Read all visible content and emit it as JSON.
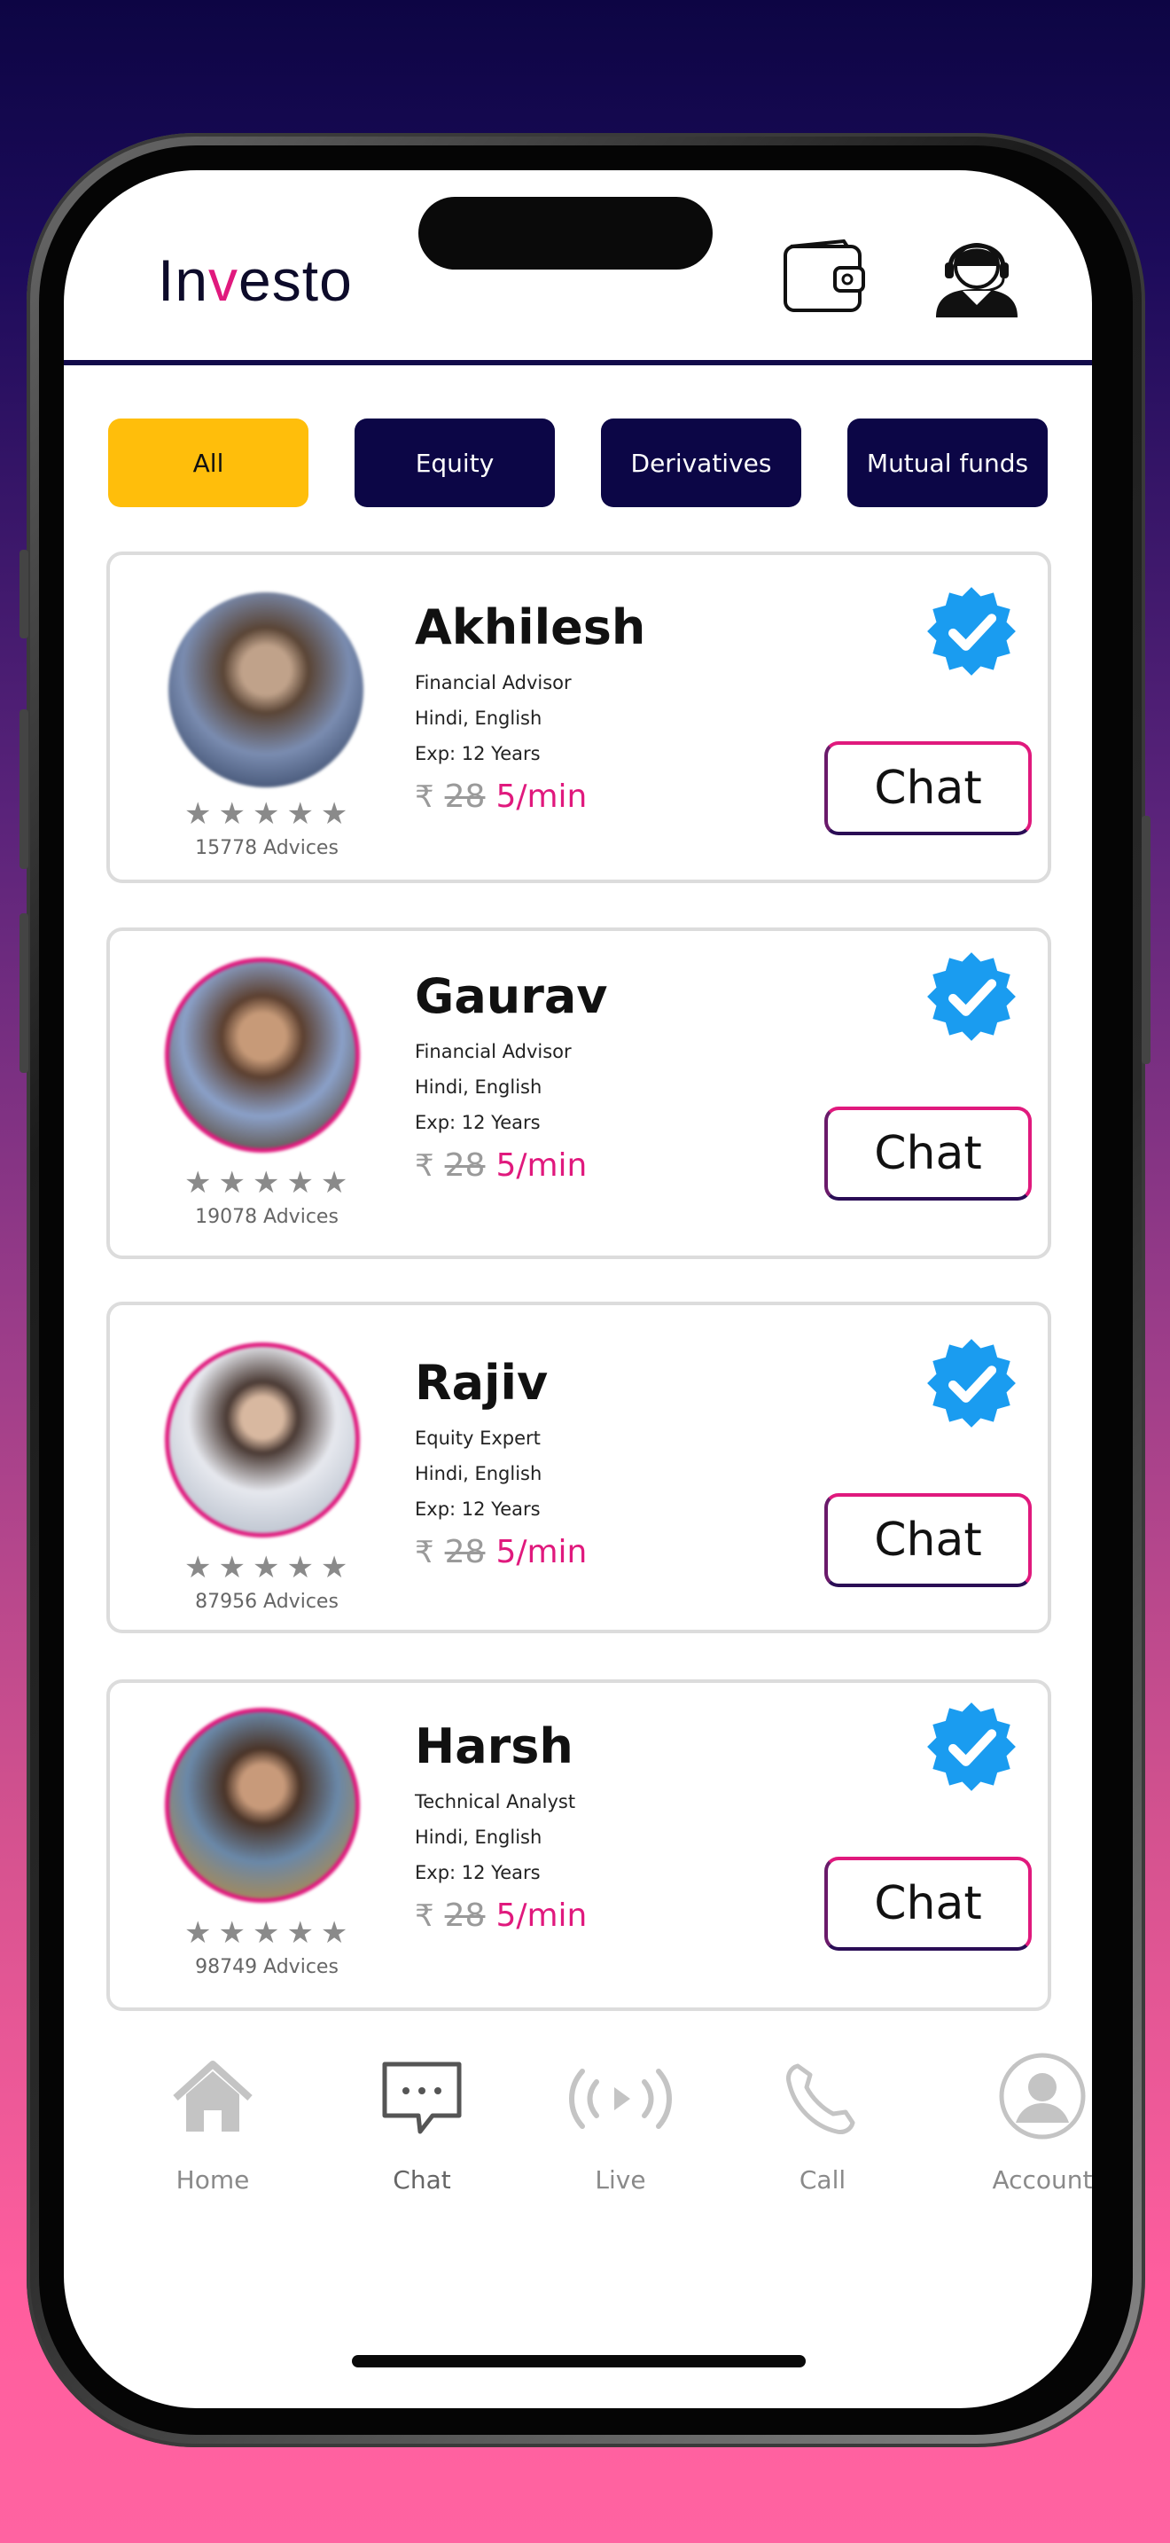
{
  "app": {
    "title": "Investo",
    "title_pre": "In",
    "title_v": "v",
    "title_post": "esto"
  },
  "header": {
    "wallet_icon": "wallet-icon",
    "support_icon": "support-agent-icon"
  },
  "filters": [
    {
      "label": "All",
      "active": true
    },
    {
      "label": "Equity",
      "active": false
    },
    {
      "label": "Derivatives",
      "active": false
    },
    {
      "label": "Mutual funds",
      "active": false
    }
  ],
  "advisors": [
    {
      "name": "Akhilesh",
      "role": "Financial Advisor",
      "languages": "Hindi, English",
      "experience": "Exp: 12 Years",
      "currency": "₹",
      "old_price": "28",
      "price": "5/min",
      "rating_stars": "★★★★★",
      "advices": "15778 Advices",
      "chat_label": "Chat"
    },
    {
      "name": "Gaurav",
      "role": "Financial Advisor",
      "languages": "Hindi, English",
      "experience": "Exp: 12 Years",
      "currency": "₹",
      "old_price": "28",
      "price": "5/min",
      "rating_stars": "★★★★★",
      "advices": "19078 Advices",
      "chat_label": "Chat"
    },
    {
      "name": "Rajiv",
      "role": "Equity Expert",
      "languages": "Hindi, English",
      "experience": "Exp: 12 Years",
      "currency": "₹",
      "old_price": "28",
      "price": "5/min",
      "rating_stars": "★★★★★",
      "advices": "87956 Advices",
      "chat_label": "Chat"
    },
    {
      "name": "Harsh",
      "role": "Technical Analyst",
      "languages": "Hindi, English",
      "experience": "Exp: 12 Years",
      "currency": "₹",
      "old_price": "28",
      "price": "5/min",
      "rating_stars": "★★★★★",
      "advices": "98749 Advices",
      "chat_label": "Chat"
    }
  ],
  "nav": [
    {
      "label": "Home",
      "icon": "home-icon"
    },
    {
      "label": "Chat",
      "icon": "chat-icon"
    },
    {
      "label": "Live",
      "icon": "live-icon"
    },
    {
      "label": "Call",
      "icon": "call-icon"
    },
    {
      "label": "Account",
      "icon": "account-icon"
    }
  ],
  "colors": {
    "accent": "#e0197d",
    "navy": "#0c0646",
    "active_tab": "#ffbe0b",
    "verified": "#1a9cf0"
  }
}
